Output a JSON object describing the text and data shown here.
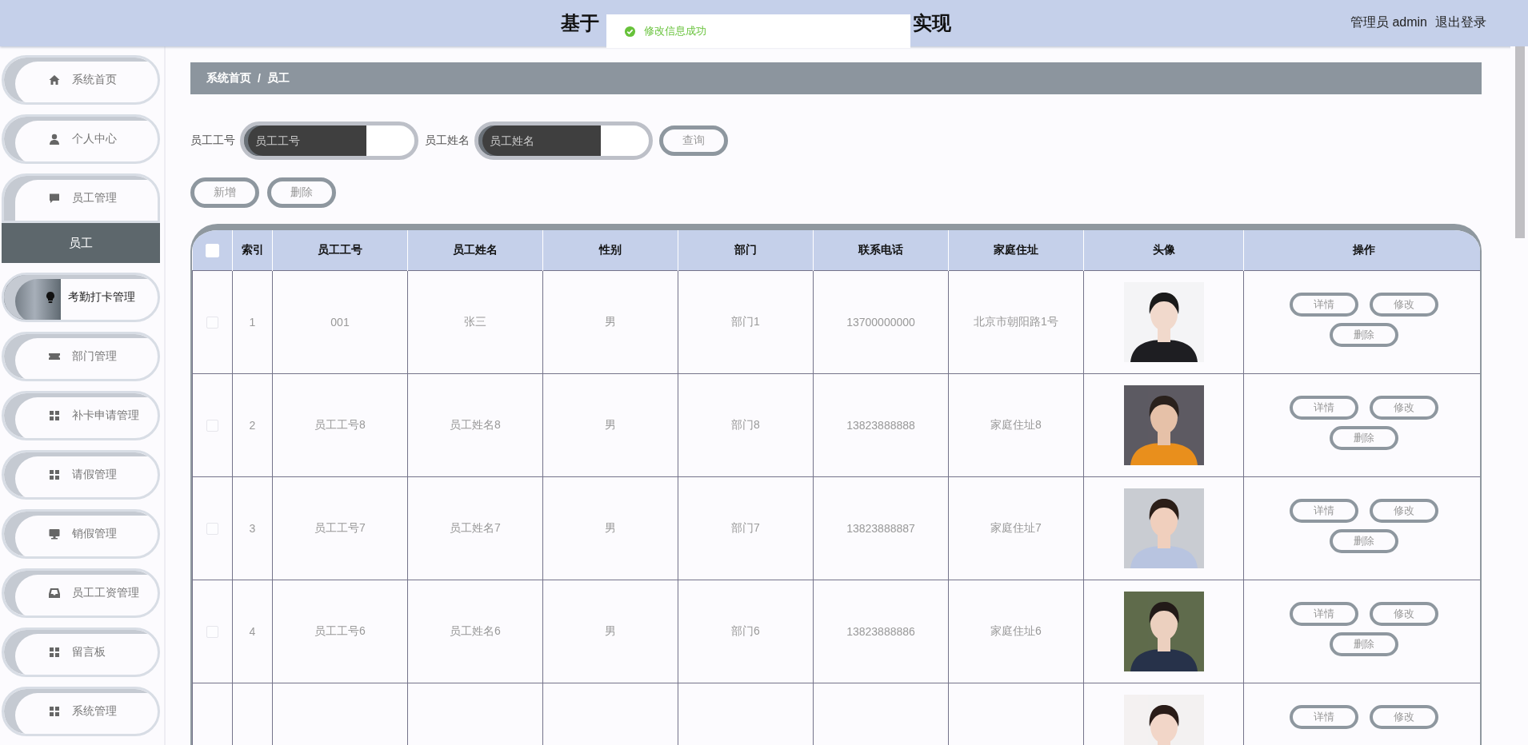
{
  "header": {
    "title_visible": [
      "基于",
      "实现"
    ],
    "user": "管理员 admin",
    "logout": "退出登录"
  },
  "toast": {
    "message": "修改信息成功"
  },
  "sidebar": {
    "items": [
      {
        "label": "系统首页",
        "expanded": false,
        "hovered": false
      },
      {
        "label": "个人中心",
        "expanded": false,
        "hovered": false
      },
      {
        "label": "员工管理",
        "expanded": true,
        "hovered": false,
        "children": [
          {
            "label": "员工",
            "selected": true
          }
        ]
      },
      {
        "label": "考勤打卡管理",
        "expanded": false,
        "hovered": true
      },
      {
        "label": "部门管理",
        "expanded": false,
        "hovered": false
      },
      {
        "label": "补卡申请管理",
        "expanded": false,
        "hovered": false
      },
      {
        "label": "请假管理",
        "expanded": false,
        "hovered": false
      },
      {
        "label": "销假管理",
        "expanded": false,
        "hovered": false
      },
      {
        "label": "员工工资管理",
        "expanded": false,
        "hovered": false
      },
      {
        "label": "留言板",
        "expanded": false,
        "hovered": false
      },
      {
        "label": "系统管理",
        "expanded": false,
        "hovered": false
      }
    ]
  },
  "breadcrumb": {
    "items": [
      "系统首页",
      "员工"
    ],
    "separator": "/"
  },
  "search": {
    "fields": [
      {
        "label": "员工工号",
        "placeholder": "员工工号"
      },
      {
        "label": "员工姓名",
        "placeholder": "员工姓名"
      }
    ],
    "button": "查询"
  },
  "actions": [
    "新增",
    "删除"
  ],
  "table": {
    "header_checkbox": {
      "checked": false
    },
    "columns": [
      "索引",
      "员工工号",
      "员工姓名",
      "性别",
      "部门",
      "联系电话",
      "家庭住址",
      "头像",
      "操作"
    ],
    "rows": [
      {
        "checked": false,
        "cells": [
          "1",
          "001",
          "张三",
          "男",
          "部门1",
          "13700000000",
          "北京市朝阳路1号"
        ],
        "avatar": {
          "kind": "picture"
        },
        "actions": [
          "详情",
          "修改",
          "删除"
        ]
      },
      {
        "checked": false,
        "cells": [
          "2",
          "员工工号8",
          "员工姓名8",
          "男",
          "部门8",
          "13823888888",
          "家庭住址8"
        ],
        "avatar": {
          "kind": "picture"
        },
        "actions": [
          "详情",
          "修改",
          "删除"
        ]
      },
      {
        "checked": false,
        "cells": [
          "3",
          "员工工号7",
          "员工姓名7",
          "男",
          "部门7",
          "13823888887",
          "家庭住址7"
        ],
        "avatar": {
          "kind": "picture"
        },
        "actions": [
          "详情",
          "修改",
          "删除"
        ]
      },
      {
        "checked": false,
        "cells": [
          "4",
          "员工工号6",
          "员工姓名6",
          "男",
          "部门6",
          "13823888886",
          "家庭住址6"
        ],
        "avatar": {
          "kind": "picture"
        },
        "actions": [
          "详情",
          "修改",
          "删除"
        ]
      },
      {
        "avatar": {
          "kind": "picture"
        },
        "actions": [
          "详情",
          "修改"
        ]
      }
    ]
  }
}
